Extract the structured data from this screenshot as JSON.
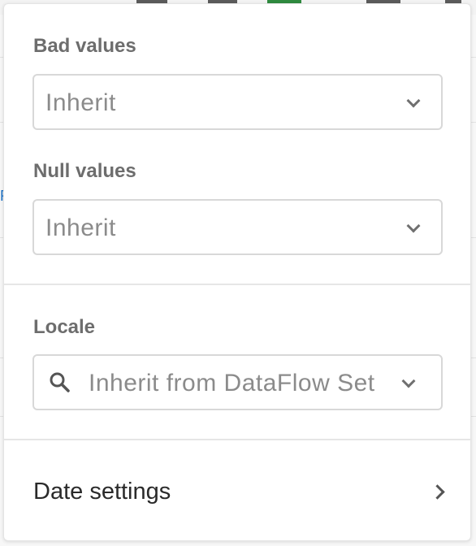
{
  "popover": {
    "bad_values": {
      "label": "Bad values",
      "value": "Inherit"
    },
    "null_values": {
      "label": "Null values",
      "value": "Inherit"
    },
    "locale": {
      "label": "Locale",
      "value": "Inherit from DataFlow Set"
    },
    "date_settings": {
      "label": "Date settings"
    }
  },
  "icons": {
    "dropdown": "chevron-down-icon",
    "locale_search": "search-icon",
    "date_settings": "chevron-right-icon"
  },
  "colors": {
    "label": "#6d6d6d",
    "field_border": "#d8d8d8",
    "field_text": "#8b8b8b",
    "title_text": "#2a2a2a"
  }
}
